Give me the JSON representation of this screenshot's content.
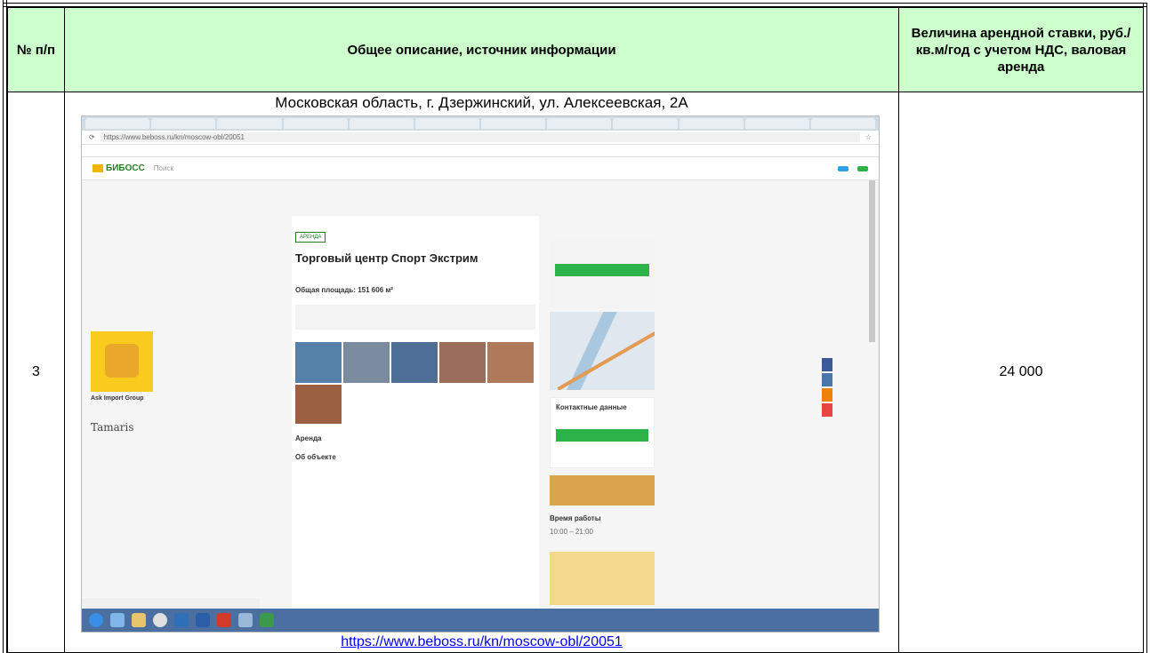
{
  "header": {
    "col_number": "№ п/п",
    "col_description": "Общее описание, источник информации",
    "col_rate": "Величина арендной ставки, руб./ кв.м/год с учетом НДС, валовая аренда"
  },
  "row": {
    "number": "3",
    "address": "Московская область, г. Дзержинский, ул. Алексеевская, 2А",
    "rate": "24 000",
    "source_link": "https://www.beboss.ru/kn/moscow-obl/20051"
  },
  "screenshot": {
    "site_logo": "БИБОСС",
    "search_label": "Поиск",
    "url": "https://www.beboss.ru/kn/moscow-obl/20051",
    "listing_badge": "АРЕНДА",
    "listing_title": "Торговый центр Спорт Экстрим",
    "total_area": "Общая площадь: 151 606 м²",
    "section_rent": "Аренда",
    "section_about": "Об объекте",
    "contacts_title": "Контактные данные",
    "hours_title": "Время работы",
    "hours_value": "10:00 – 21:00",
    "ad_title": "Ask Import Group",
    "ad_brand": "Tamaris",
    "colors": {
      "header_bg": "#ccffcc",
      "link": "#0000ee",
      "site_green": "#2bb34a",
      "site_blue": "#2ea0e8"
    }
  }
}
